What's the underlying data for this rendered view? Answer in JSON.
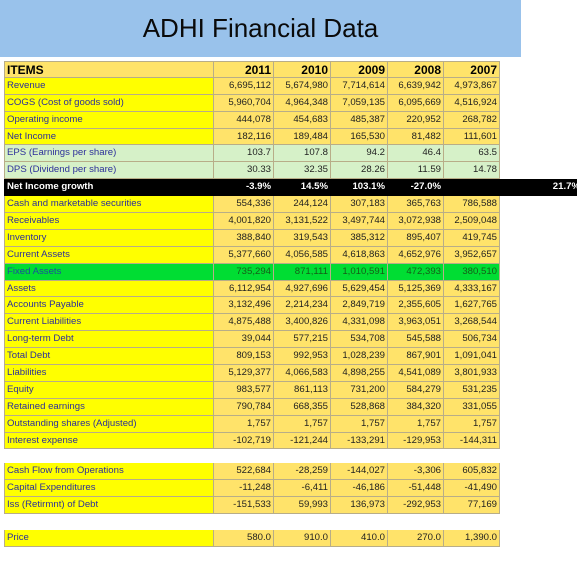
{
  "title": "ADHI Financial Data",
  "header": {
    "label": "ITEMS",
    "years": [
      "2011",
      "2010",
      "2009",
      "2008",
      "2007"
    ]
  },
  "rows": [
    {
      "label": "Revenue",
      "values": [
        "6,695,112",
        "5,674,980",
        "7,714,614",
        "6,639,942",
        "4,973,867"
      ]
    },
    {
      "label": "COGS (Cost of goods sold)",
      "values": [
        "5,960,704",
        "4,964,348",
        "7,059,135",
        "6,095,669",
        "4,516,924"
      ]
    },
    {
      "label": "Operating income",
      "values": [
        "444,078",
        "454,683",
        "485,387",
        "220,952",
        "268,782"
      ]
    },
    {
      "label": "Net Income",
      "values": [
        "182,116",
        "189,484",
        "165,530",
        "81,482",
        "111,601"
      ]
    },
    {
      "label": "EPS (Earnings per share)",
      "values": [
        "103.7",
        "107.8",
        "94.2",
        "46.4",
        "63.5"
      ]
    },
    {
      "label": "DPS (Dividend per share)",
      "values": [
        "30.33",
        "32.35",
        "28.26",
        "11.59",
        "14.78"
      ]
    }
  ],
  "growth": {
    "label": "Net Income growth",
    "values": [
      "-3.9%",
      "14.5%",
      "103.1%",
      "-27.0%",
      ""
    ],
    "extra": "21.7%"
  },
  "rows2": [
    {
      "label": "Cash and marketable securities",
      "values": [
        "554,336",
        "244,124",
        "307,183",
        "365,763",
        "786,588"
      ]
    },
    {
      "label": "Receivables",
      "values": [
        "4,001,820",
        "3,131,522",
        "3,497,744",
        "3,072,938",
        "2,509,048"
      ]
    },
    {
      "label": "Inventory",
      "values": [
        "388,840",
        "319,543",
        "385,312",
        "895,407",
        "419,745"
      ]
    },
    {
      "label": "Current Assets",
      "values": [
        "5,377,660",
        "4,056,585",
        "4,618,863",
        "4,652,976",
        "3,952,657"
      ]
    }
  ],
  "fixed": {
    "label": "Fixed Assets",
    "values": [
      "735,294",
      "871,111",
      "1,010,591",
      "472,393",
      "380,510"
    ]
  },
  "rows3": [
    {
      "label": "Assets",
      "values": [
        "6,112,954",
        "4,927,696",
        "5,629,454",
        "5,125,369",
        "4,333,167"
      ]
    },
    {
      "label": "Accounts Payable",
      "values": [
        "3,132,496",
        "2,214,234",
        "2,849,719",
        "2,355,605",
        "1,627,765"
      ]
    },
    {
      "label": "Current Liabilities",
      "values": [
        "4,875,488",
        "3,400,826",
        "4,331,098",
        "3,963,051",
        "3,268,544"
      ]
    },
    {
      "label": "Long-term Debt",
      "values": [
        "39,044",
        "577,215",
        "534,708",
        "545,588",
        "506,734"
      ]
    },
    {
      "label": "Total Debt",
      "values": [
        "809,153",
        "992,953",
        "1,028,239",
        "867,901",
        "1,091,041"
      ]
    },
    {
      "label": "Liabilities",
      "values": [
        "5,129,377",
        "4,066,583",
        "4,898,255",
        "4,541,089",
        "3,801,933"
      ]
    },
    {
      "label": "Equity",
      "values": [
        "983,577",
        "861,113",
        "731,200",
        "584,279",
        "531,235"
      ]
    },
    {
      "label": "Retained earnings",
      "values": [
        "790,784",
        "668,355",
        "528,868",
        "384,320",
        "331,055"
      ]
    },
    {
      "label": "Outstanding shares (Adjusted)",
      "values": [
        "1,757",
        "1,757",
        "1,757",
        "1,757",
        "1,757"
      ]
    },
    {
      "label": "Interest expense",
      "values": [
        "-102,719",
        "-121,244",
        "-133,291",
        "-129,953",
        "-144,311"
      ]
    }
  ],
  "cashflow": [
    {
      "label": "Cash Flow from Operations",
      "values": [
        "522,684",
        "-28,259",
        "-144,027",
        "-3,306",
        "605,832"
      ]
    },
    {
      "label": "Capital Expenditures",
      "values": [
        "-11,248",
        "-6,411",
        "-46,186",
        "-51,448",
        "-41,490"
      ]
    },
    {
      "label": "Iss (Retirmnt) of Debt",
      "values": [
        "-151,533",
        "59,993",
        "136,973",
        "-292,953",
        "77,169"
      ]
    }
  ],
  "price": {
    "label": "Price",
    "values": [
      "580.0",
      "910.0",
      "410.0",
      "270.0",
      "1,390.0"
    ]
  }
}
